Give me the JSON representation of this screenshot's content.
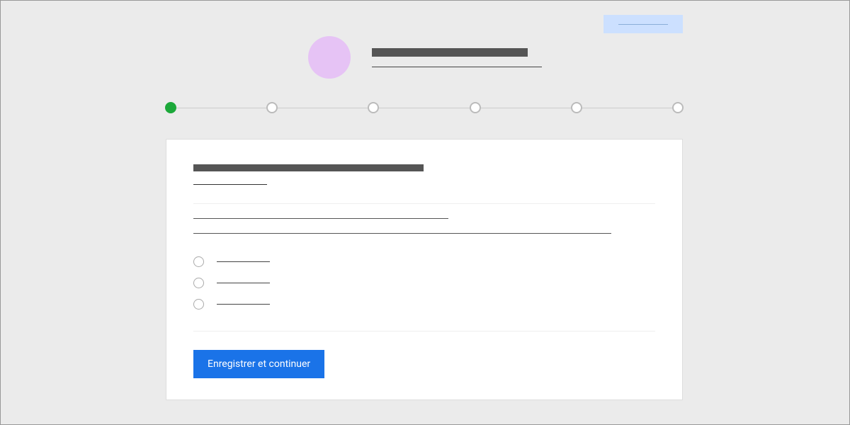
{
  "top_badge": {
    "text": ""
  },
  "header": {
    "title": "",
    "subtitle": ""
  },
  "stepper": {
    "steps": [
      {
        "active": true
      },
      {
        "active": false
      },
      {
        "active": false
      },
      {
        "active": false
      },
      {
        "active": false
      },
      {
        "active": false
      }
    ]
  },
  "form": {
    "section_title": "",
    "section_subtitle": "",
    "description_line1": "",
    "description_line2": "",
    "options": [
      {
        "label": ""
      },
      {
        "label": ""
      },
      {
        "label": ""
      }
    ],
    "submit_label": "Enregistrer et continuer"
  }
}
